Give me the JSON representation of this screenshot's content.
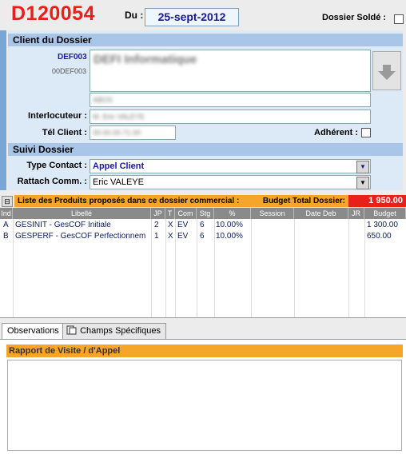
{
  "header": {
    "dossier_id": "D120054",
    "du_label": "Du :",
    "date": "25-sept-2012",
    "solde_label": "Dossier Soldé :"
  },
  "client": {
    "section_title": "Client du Dossier",
    "code1": "DEF003",
    "code2": "00DEF003",
    "name": "DEFI Informatique",
    "address": "ABOS",
    "interlocuteur_label": "Interlocuteur :",
    "interlocuteur": "M. Eric VALEYE",
    "tel_label": "Tél Client :",
    "tel": "00.00.00.71.00",
    "adherent_label": "Adhérent :"
  },
  "suivi": {
    "section_title": "Suivi Dossier",
    "type_label": "Type Contact :",
    "type_value": "Appel Client",
    "rattach_label": "Rattach Comm. :",
    "rattach_value": "Eric VALEYE"
  },
  "products": {
    "collapse_icon": "⊟",
    "title": "Liste des Produits proposés dans ce dossier commercial :",
    "budget_label": "Budget Total Dossier:",
    "budget_total": "1 950.00",
    "columns": [
      "Ind",
      "Libellé",
      "JP",
      "T",
      "Com",
      "Stg",
      "%",
      "Session",
      "Date Deb",
      "JR",
      "Budget"
    ],
    "rows": [
      {
        "ind": "A",
        "libelle": "GESINIT - GesCOF Initiale",
        "jp": "2",
        "t": "X",
        "com": "EV",
        "stg": "6",
        "pct": "10.00%",
        "session": "",
        "date": "",
        "jr": "",
        "budget": "1 300.00"
      },
      {
        "ind": "B",
        "libelle": "GESPERF - GesCOF Perfectionnem",
        "jp": "1",
        "t": "X",
        "com": "EV",
        "stg": "6",
        "pct": "10.00%",
        "session": "",
        "date": "",
        "jr": "",
        "budget": "650.00"
      }
    ]
  },
  "tabs": {
    "observations": "Observations",
    "champs": "Champs Spécifiques"
  },
  "rapport": {
    "title": "Rapport de Visite / d'Appel",
    "content": ""
  },
  "colors": {
    "accent_red": "#e8201c",
    "orange": "#f5a52a",
    "panel_blue": "#dce9f7"
  }
}
